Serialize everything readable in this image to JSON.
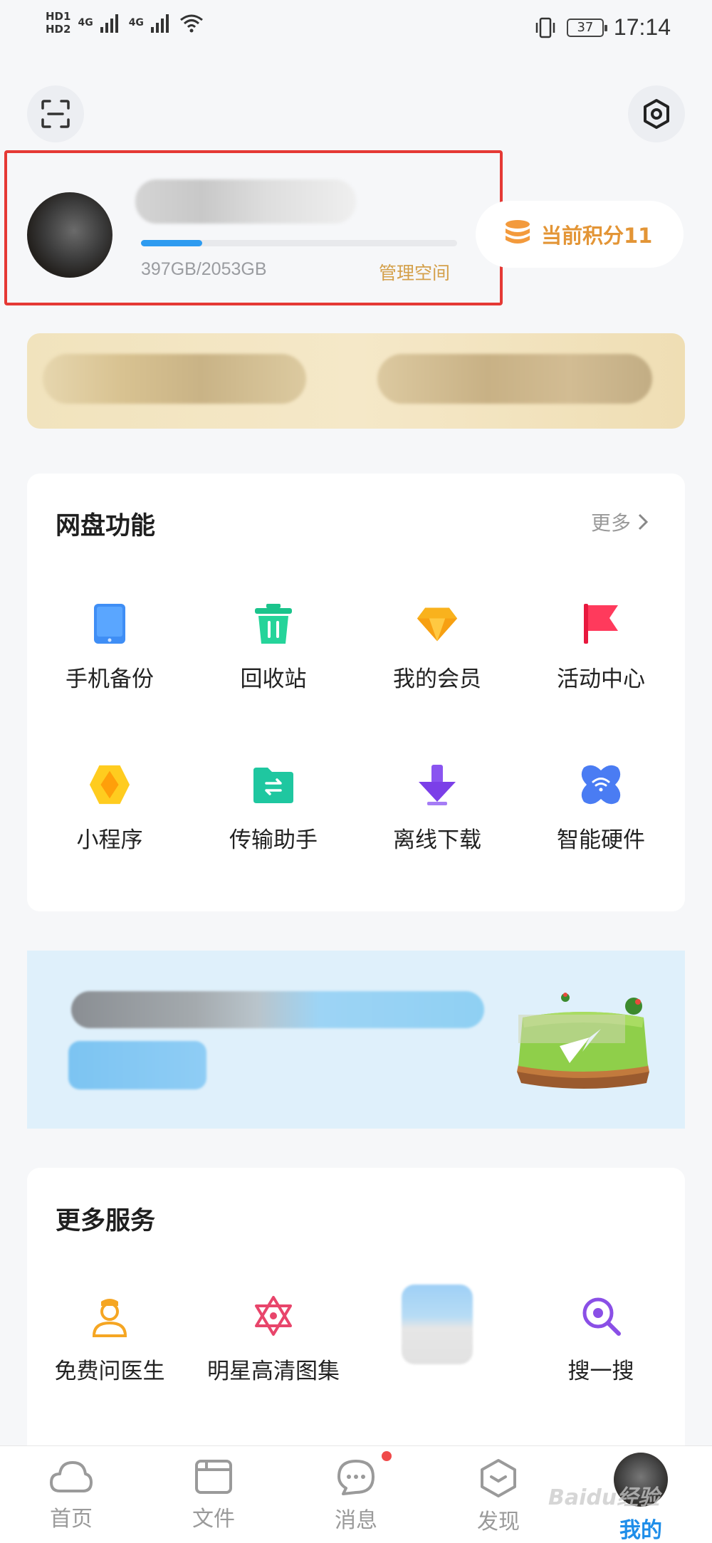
{
  "status_bar": {
    "sim1": "HD1",
    "sim2": "HD2",
    "net1": "4G",
    "net2": "4G",
    "battery": "37",
    "time": "17:14"
  },
  "profile": {
    "storage_text": "397GB/2053GB",
    "storage_fraction": 0.193,
    "manage_label": "管理空间",
    "points_label": "当前积分11"
  },
  "features": {
    "title": "网盘功能",
    "more_label": "更多",
    "items": [
      {
        "label": "手机备份",
        "icon": "phone-backup-icon"
      },
      {
        "label": "回收站",
        "icon": "trash-icon"
      },
      {
        "label": "我的会员",
        "icon": "gem-icon"
      },
      {
        "label": "活动中心",
        "icon": "flag-icon"
      },
      {
        "label": "小程序",
        "icon": "hexagon-diamond-icon"
      },
      {
        "label": "传输助手",
        "icon": "transfer-folder-icon"
      },
      {
        "label": "离线下载",
        "icon": "download-arrow-icon"
      },
      {
        "label": "智能硬件",
        "icon": "wifi-device-icon"
      }
    ]
  },
  "services": {
    "title": "更多服务",
    "items": [
      {
        "label": "免费问医生",
        "icon": "doctor-icon"
      },
      {
        "label": "明星高清图集",
        "icon": "star-gallery-icon"
      },
      {
        "label": "",
        "icon": "blurred-icon"
      },
      {
        "label": "搜一搜",
        "icon": "search-icon"
      }
    ]
  },
  "nav": {
    "items": [
      {
        "label": "首页",
        "icon": "cloud-icon"
      },
      {
        "label": "文件",
        "icon": "folder-icon"
      },
      {
        "label": "消息",
        "icon": "chat-icon"
      },
      {
        "label": "发现",
        "icon": "discover-icon"
      },
      {
        "label": "我的",
        "icon": "avatar"
      }
    ]
  },
  "watermark": "Baidu经验",
  "colors": {
    "accent": "#1f8ee9",
    "highlight_border": "#e53935",
    "points": "#e39536",
    "manage": "#d4a04a"
  }
}
